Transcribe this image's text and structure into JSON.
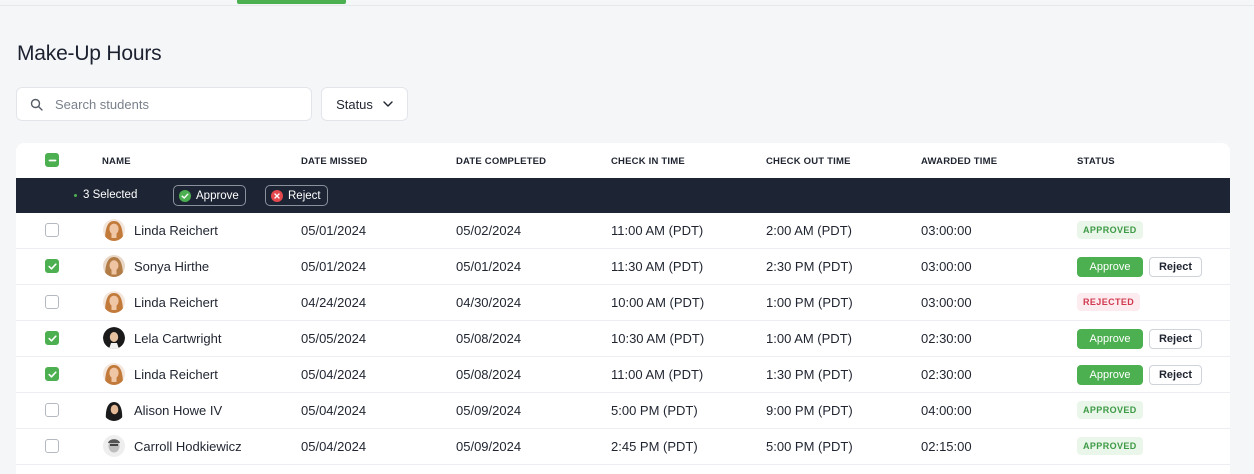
{
  "page": {
    "title": "Make-Up Hours"
  },
  "search": {
    "placeholder": "Search students"
  },
  "filter": {
    "status_label": "Status"
  },
  "columns": [
    "NAME",
    "DATE MISSED",
    "DATE COMPLETED",
    "CHECK IN TIME",
    "CHECK OUT TIME",
    "AWARDED TIME",
    "STATUS"
  ],
  "selection": {
    "count_label": "3 Selected",
    "approve_label": "Approve",
    "reject_label": "Reject"
  },
  "actions": {
    "approve_label": "Approve",
    "reject_label": "Reject"
  },
  "colors": {
    "accent": "#4caf50",
    "selection_bar": "#1d2433",
    "reject_icon": "#e5484d",
    "rejected_text": "#d0394f"
  },
  "rows": [
    {
      "checked": false,
      "name": "Linda Reichert",
      "date_missed": "05/01/2024",
      "date_completed": "05/02/2024",
      "check_in": "11:00 AM (PDT)",
      "check_out": "2:00 AM (PDT)",
      "awarded": "03:00:00",
      "status": "APPROVED"
    },
    {
      "checked": true,
      "name": "Sonya Hirthe",
      "date_missed": "05/01/2024",
      "date_completed": "05/01/2024",
      "check_in": "11:30 AM (PDT)",
      "check_out": "2:30 PM (PDT)",
      "awarded": "03:00:00",
      "status": ""
    },
    {
      "checked": false,
      "name": "Linda Reichert",
      "date_missed": "04/24/2024",
      "date_completed": "04/30/2024",
      "check_in": "10:00 AM (PDT)",
      "check_out": "1:00 PM (PDT)",
      "awarded": "03:00:00",
      "status": "REJECTED"
    },
    {
      "checked": true,
      "name": "Lela Cartwright",
      "date_missed": "05/05/2024",
      "date_completed": "05/08/2024",
      "check_in": "10:30 AM (PDT)",
      "check_out": "1:00 AM (PDT)",
      "awarded": "02:30:00",
      "status": ""
    },
    {
      "checked": true,
      "name": "Linda Reichert",
      "date_missed": "05/04/2024",
      "date_completed": "05/08/2024",
      "check_in": "11:00 AM (PDT)",
      "check_out": "1:30 PM (PDT)",
      "awarded": "02:30:00",
      "status": ""
    },
    {
      "checked": false,
      "name": "Alison Howe IV",
      "date_missed": "05/04/2024",
      "date_completed": "05/09/2024",
      "check_in": "5:00 PM (PDT)",
      "check_out": "9:00 PM (PDT)",
      "awarded": "04:00:00",
      "status": "APPROVED"
    },
    {
      "checked": false,
      "name": "Carroll Hodkiewicz",
      "date_missed": "05/04/2024",
      "date_completed": "05/09/2024",
      "check_in": "2:45 PM (PDT)",
      "check_out": "5:00 PM (PDT)",
      "awarded": "02:15:00",
      "status": "APPROVED"
    }
  ]
}
